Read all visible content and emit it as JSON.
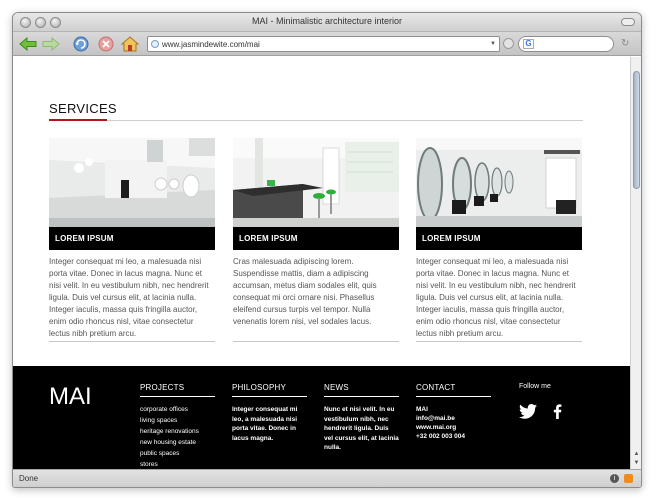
{
  "browser": {
    "window_title": "MAI - Minimalistic architecture interior",
    "url": "www.jasmindewite.com/mai",
    "status": "Done"
  },
  "services": {
    "heading": "SERVICES",
    "accent_color": "#b3141b",
    "cards": [
      {
        "label": "LOREM IPSUM",
        "text": "Integer consequat mi leo, a malesuada nisi porta vitae. Donec in lacus magna. Nunc et nisi velit. In eu vestibulum nibh, nec hendrerit ligula. Duis vel cursus elit, at lacinia nulla. Integer iaculis, massa quis fringilla auctor, enim odio rhoncus nisl, vitae consectetur lectus nibh pretium arcu."
      },
      {
        "label": "LOREM IPSUM",
        "text": "Cras malesuada adipiscing lorem. Suspendisse mattis, diam a adipiscing accumsan, metus diam sodales elit, quis consequat mi orci ornare nisi. Phasellus eleifend cursus turpis vel tempor. Nulla venenatis lorem nisi, vel sodales lacus."
      },
      {
        "label": "LOREM IPSUM",
        "text": "Integer consequat mi leo, a malesuada nisi porta vitae. Donec in lacus magna. Nunc et nisi velit. In eu vestibulum nibh, nec hendrerit ligula. Duis vel cursus elit, at lacinia nulla. Integer iaculis, massa quis fringilla auctor, enim odio rhoncus nisl, vitae consectetur lectus nibh pretium arcu."
      }
    ]
  },
  "footer": {
    "logo": "MAI",
    "projects": {
      "heading": "PROJECTS",
      "items": [
        "corporate offices",
        "living spaces",
        "heritage renovations",
        "new housing estate",
        "public spaces",
        "stores"
      ]
    },
    "philosophy": {
      "heading": "PHILOSOPHY",
      "text": "Integer consequat mi leo, a malesuada nisi porta vitae. Donec in lacus magna."
    },
    "news": {
      "heading": "NEWS",
      "text": "Nunc et nisi velit. In eu vestibulum nibh, nec hendrerit ligula. Duis vel cursus elit, at lacinia nulla."
    },
    "contact": {
      "heading": "CONTACT",
      "lines": [
        "MAI",
        "info@mai.be",
        "www.mai.org",
        "+32 002 003 004"
      ]
    },
    "follow_label": "Follow me"
  }
}
